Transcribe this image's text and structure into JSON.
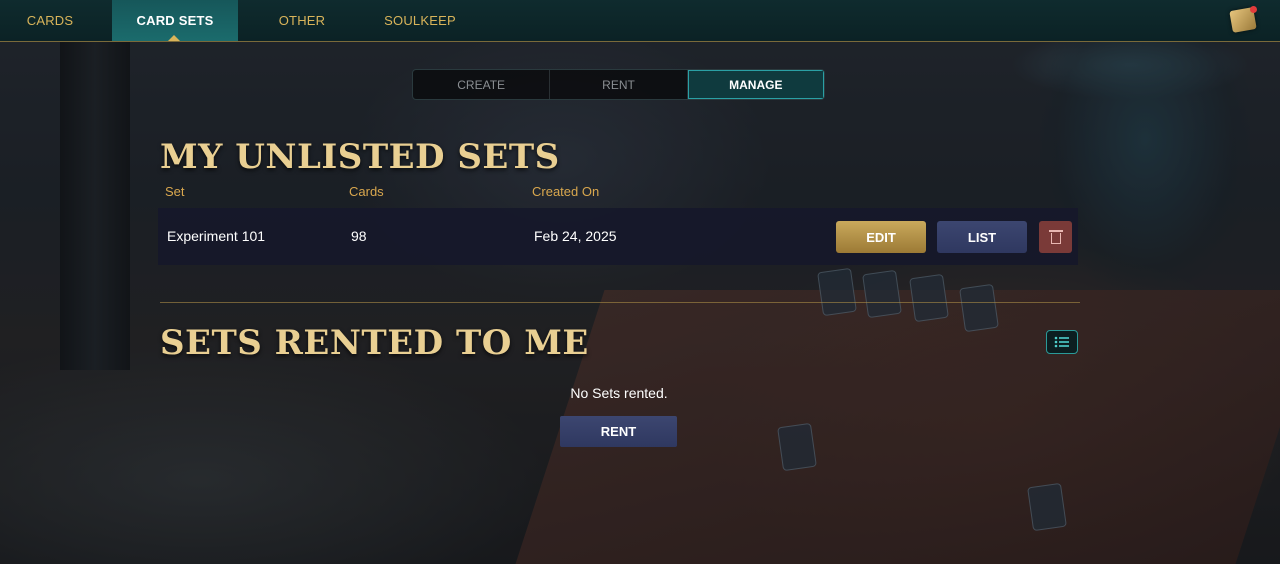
{
  "nav": {
    "items": [
      {
        "label": "CARDS"
      },
      {
        "label": "CARD SETS"
      },
      {
        "label": "OTHER"
      },
      {
        "label": "SOULKEEP"
      }
    ],
    "active": "CARD SETS"
  },
  "tabs": {
    "items": [
      {
        "label": "CREATE"
      },
      {
        "label": "RENT"
      },
      {
        "label": "MANAGE"
      }
    ],
    "active": "MANAGE"
  },
  "unlisted": {
    "title": "MY UNLISTED SETS",
    "columns": [
      "Set",
      "Cards",
      "Created On"
    ],
    "rows": [
      {
        "set": "Experiment 101",
        "cards": "98",
        "created_on": "Feb 24, 2025"
      }
    ],
    "edit_label": "EDIT",
    "list_label": "LIST"
  },
  "rented": {
    "title": "SETS RENTED TO ME",
    "empty_message": "No Sets rented.",
    "rent_label": "RENT"
  },
  "icons": {
    "avatar": "treasure-chest-icon",
    "delete": "trash-icon",
    "view_toggle": "list-view-icon"
  },
  "colors": {
    "accent_gold": "#e9cf92",
    "teal": "#1b6b6c",
    "edit_button": "#c9a95c",
    "list_button": "#3c4670",
    "delete_button": "#7a3a38"
  }
}
